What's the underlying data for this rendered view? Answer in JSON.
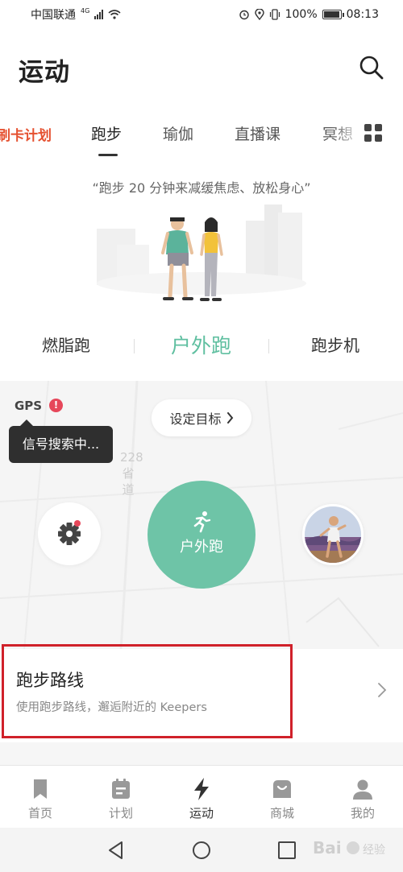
{
  "status_bar": {
    "carrier": "中国联通",
    "network": "4G",
    "battery": "100%",
    "battery_level": 1.0,
    "time": "08:13"
  },
  "header": {
    "title": "运动"
  },
  "tabs": {
    "items": [
      {
        "label": "刷卡计划"
      },
      {
        "label": "跑步"
      },
      {
        "label": "瑜伽"
      },
      {
        "label": "直播课"
      },
      {
        "label": "冥想"
      }
    ],
    "active_index": 1
  },
  "hero": {
    "quote": "“跑步 20 分钟来减缓焦虑、放松身心”"
  },
  "run_modes": {
    "items": [
      {
        "label": "燃脂跑"
      },
      {
        "label": "户外跑"
      },
      {
        "label": "跑步机"
      }
    ],
    "active_index": 1
  },
  "map_panel": {
    "gps_label": "GPS",
    "gps_alert": "!",
    "tooltip": "信号搜索中...",
    "goal_button": "设定目标",
    "road_label": "228省道",
    "start_button": "户外跑"
  },
  "route_card": {
    "title": "跑步路线",
    "subtitle": "使用跑步路线，邂逅附近的 Keepers"
  },
  "bottom_nav": {
    "items": [
      {
        "label": "首页",
        "icon": "bookmark-icon"
      },
      {
        "label": "计划",
        "icon": "calendar-icon"
      },
      {
        "label": "运动",
        "icon": "lightning-icon"
      },
      {
        "label": "商城",
        "icon": "shopping-bag-icon"
      },
      {
        "label": "我的",
        "icon": "person-icon"
      }
    ],
    "active_index": 2
  },
  "colors": {
    "accent": "#6ec4a7",
    "plan_tab": "#e5502f",
    "alert": "#e6475a"
  }
}
